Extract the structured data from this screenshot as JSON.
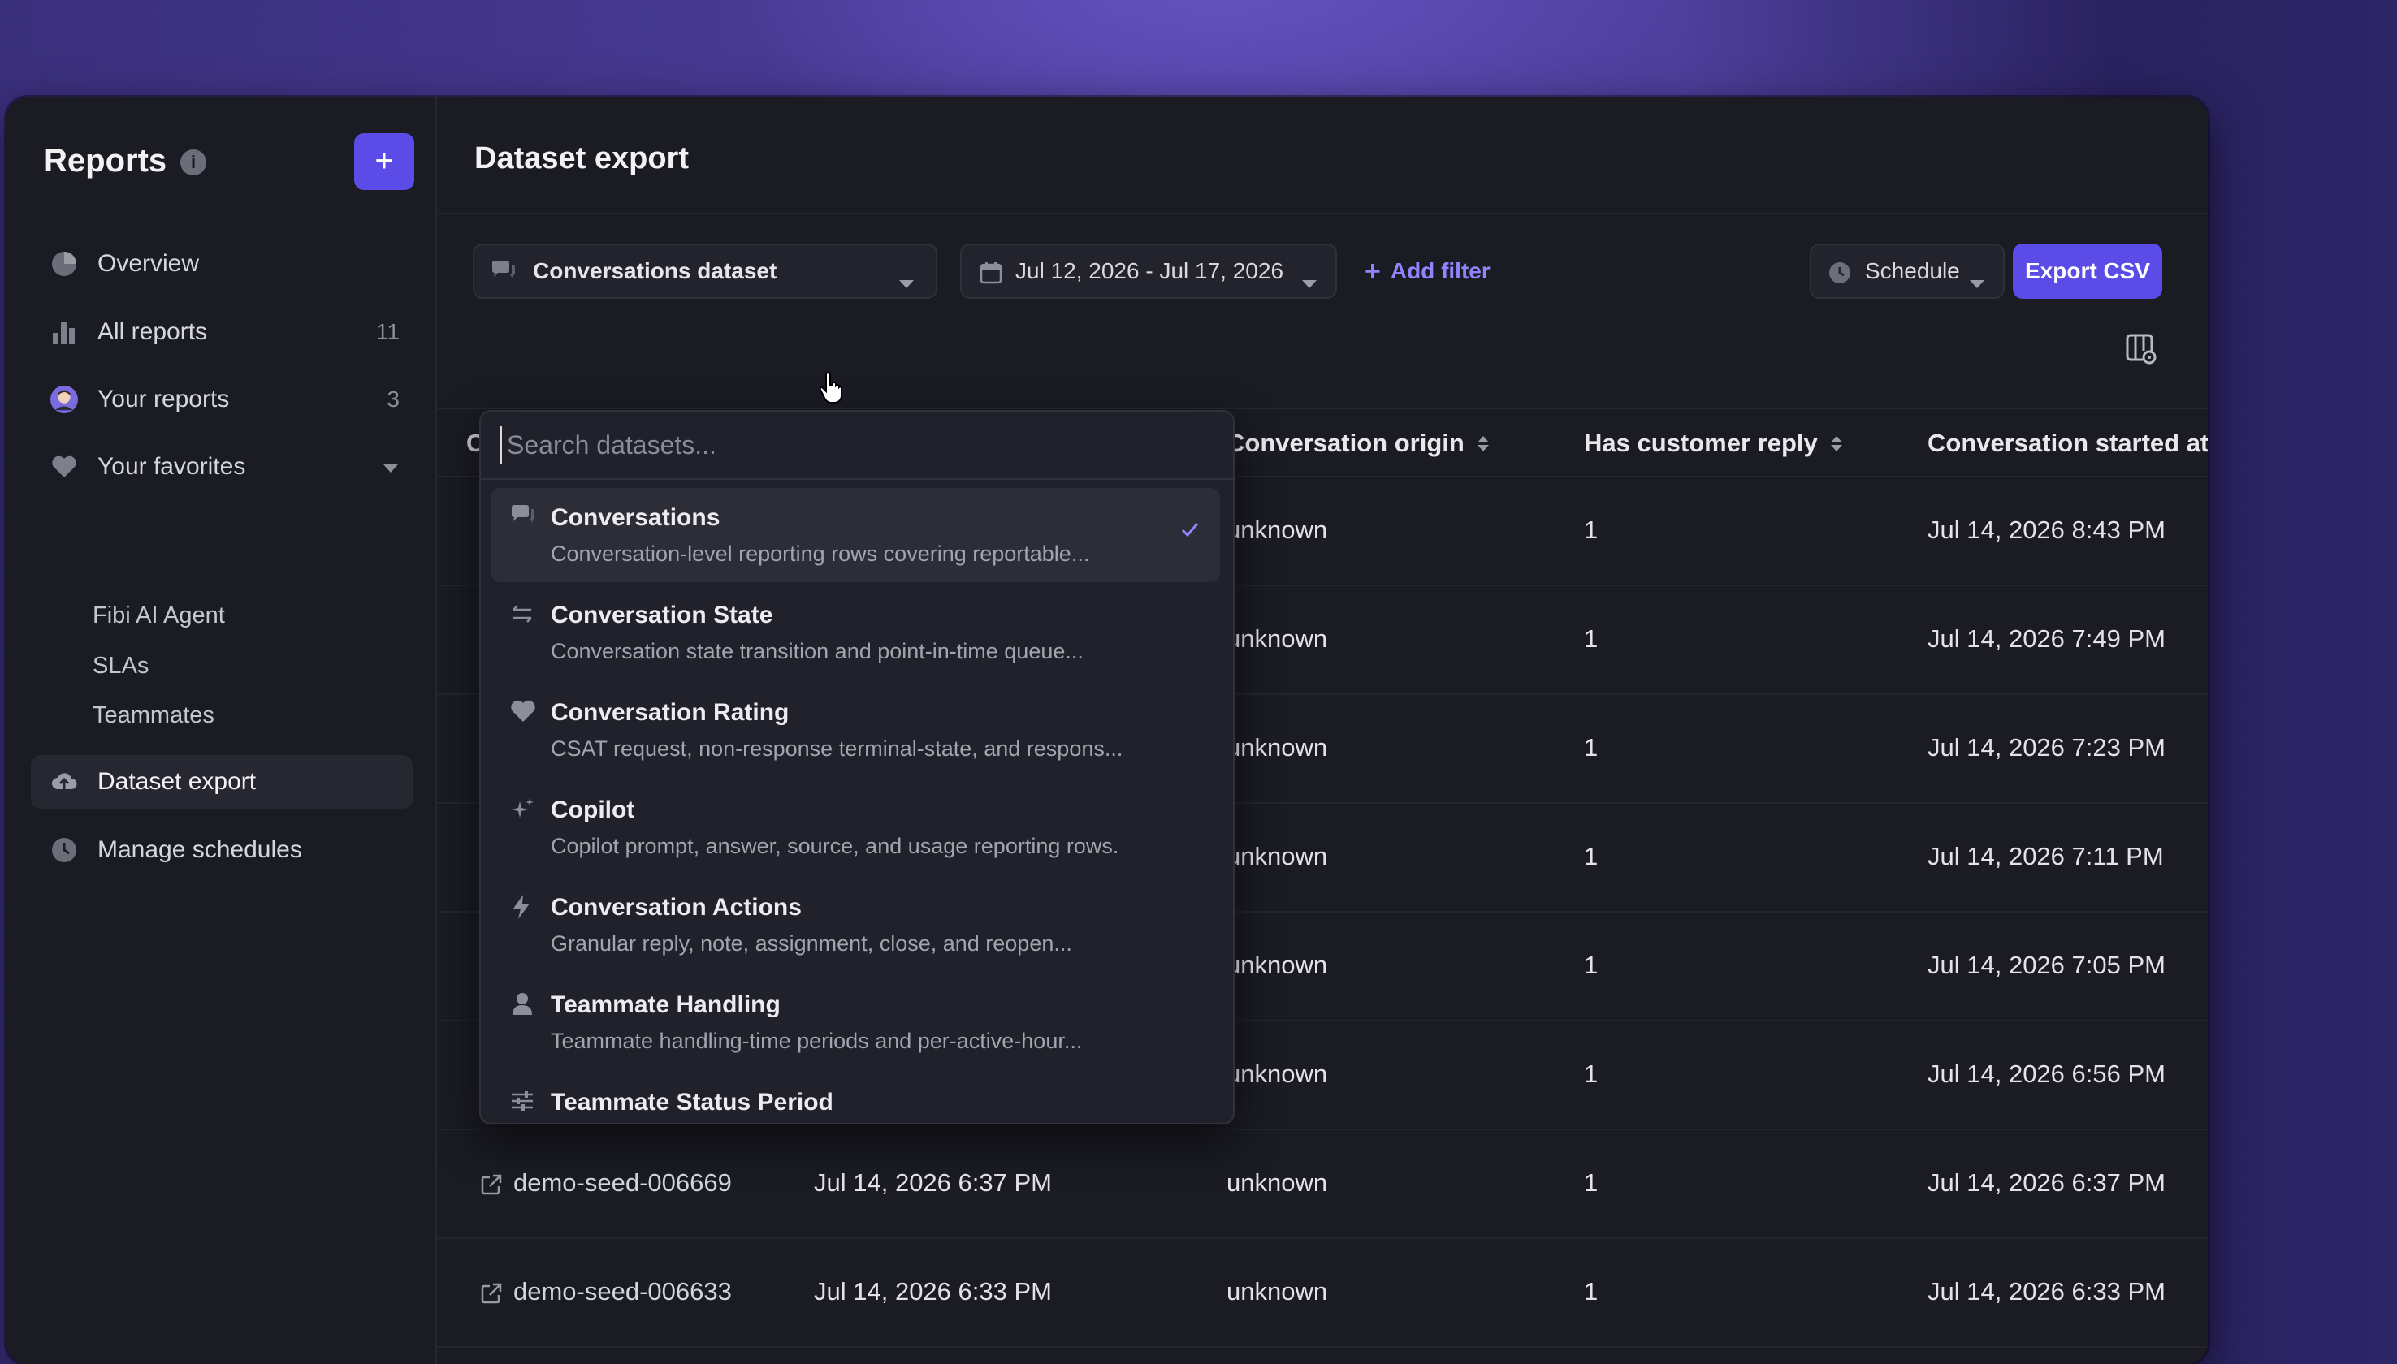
{
  "sidebar": {
    "title": "Reports",
    "nav": [
      {
        "label": "Overview",
        "icon": "pie-chart-icon"
      },
      {
        "label": "All reports",
        "count": "11",
        "icon": "bar-chart-icon"
      },
      {
        "label": "Your reports",
        "count": "3",
        "icon": "user-avatar-icon"
      },
      {
        "label": "Your favorites",
        "icon": "heart-icon"
      }
    ],
    "favorites": [
      "Fibi AI Agent",
      "SLAs",
      "Teammates"
    ],
    "bottom": [
      {
        "label": "Dataset export",
        "icon": "cloud-export-icon"
      },
      {
        "label": "Manage schedules",
        "icon": "clock-icon"
      }
    ]
  },
  "main": {
    "title": "Dataset export",
    "dataset_select": "Conversations dataset",
    "date_range": "Jul 12, 2026 - Jul 17, 2026",
    "add_filter": "Add filter",
    "schedule": "Schedule",
    "export": "Export CSV"
  },
  "table": {
    "columns": [
      "Conversation origin",
      "Has customer reply",
      "Conversation started at"
    ],
    "rows": [
      {
        "id": "",
        "date": "",
        "origin": "unknown",
        "reply": "1",
        "started": "Jul 14, 2026 8:43 PM"
      },
      {
        "id": "",
        "date": "",
        "origin": "unknown",
        "reply": "1",
        "started": "Jul 14, 2026 7:49 PM"
      },
      {
        "id": "",
        "date": "",
        "origin": "unknown",
        "reply": "1",
        "started": "Jul 14, 2026 7:23 PM"
      },
      {
        "id": "",
        "date": "",
        "origin": "unknown",
        "reply": "1",
        "started": "Jul 14, 2026 7:11 PM"
      },
      {
        "id": "",
        "date": "",
        "origin": "unknown",
        "reply": "1",
        "started": "Jul 14, 2026 7:05 PM"
      },
      {
        "id": "demo-seed-006692",
        "date": "Jul 14, 2026 6:56 PM",
        "origin": "unknown",
        "reply": "1",
        "started": "Jul 14, 2026 6:56 PM"
      },
      {
        "id": "demo-seed-006669",
        "date": "Jul 14, 2026 6:37 PM",
        "origin": "unknown",
        "reply": "1",
        "started": "Jul 14, 2026 6:37 PM"
      },
      {
        "id": "demo-seed-006633",
        "date": "Jul 14, 2026 6:33 PM",
        "origin": "unknown",
        "reply": "1",
        "started": "Jul 14, 2026 6:33 PM"
      }
    ]
  },
  "dropdown": {
    "placeholder": "Search datasets...",
    "items": [
      {
        "name": "Conversations",
        "desc": "Conversation-level reporting rows covering reportable...",
        "icon": "chat-bubbles-icon",
        "selected": true
      },
      {
        "name": "Conversation State",
        "desc": "Conversation state transition and point-in-time queue...",
        "icon": "arrows-swap-icon"
      },
      {
        "name": "Conversation Rating",
        "desc": "CSAT request, non-response terminal-state, and respons...",
        "icon": "heart-icon"
      },
      {
        "name": "Copilot",
        "desc": "Copilot prompt, answer, source, and usage reporting rows.",
        "icon": "sparkle-icon"
      },
      {
        "name": "Conversation Actions",
        "desc": "Granular reply, note, assignment, close, and reopen...",
        "icon": "lightning-icon"
      },
      {
        "name": "Teammate Handling",
        "desc": "Teammate handling-time periods and per-active-hour...",
        "icon": "person-icon"
      },
      {
        "name": "Teammate Status Period",
        "desc": "",
        "icon": "sliders-icon"
      }
    ]
  },
  "colors": {
    "accent": "#5b4ce8",
    "link": "#8f86ff",
    "panel": "#1a1b23"
  }
}
